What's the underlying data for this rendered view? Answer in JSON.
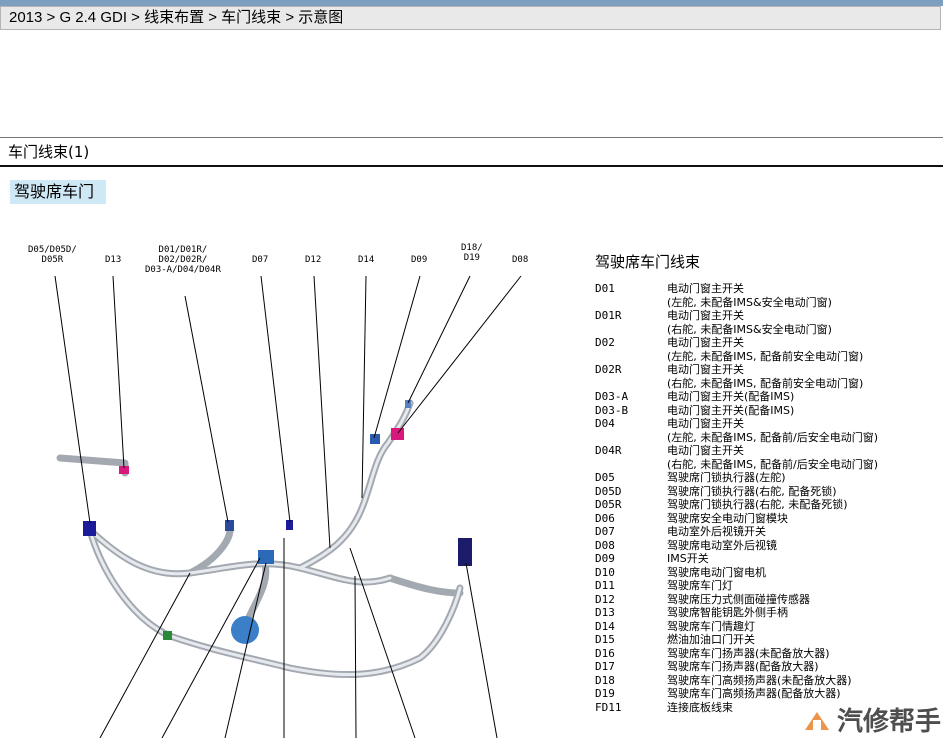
{
  "breadcrumb": "2013 > G 2.4 GDI > 线束布置 > 车门线束 > 示意图",
  "panel": {
    "title": "车门线束(1)",
    "section": "驾驶席车门"
  },
  "callouts": [
    {
      "id": "c1",
      "text": "D05/D05D/\nD05R"
    },
    {
      "id": "c2",
      "text": "D13"
    },
    {
      "id": "c3",
      "text": "D01/D01R/\nD02/D02R/\nD03-A/D04/D04R"
    },
    {
      "id": "c4",
      "text": "D07"
    },
    {
      "id": "c5",
      "text": "D12"
    },
    {
      "id": "c6",
      "text": "D14"
    },
    {
      "id": "c7",
      "text": "D09"
    },
    {
      "id": "c8",
      "text": "D18/\nD19"
    },
    {
      "id": "c9",
      "text": "D08"
    }
  ],
  "legend": {
    "title": "驾驶席车门线束",
    "items": [
      {
        "code": "D01",
        "desc": [
          "电动门窗主开关",
          "(左舵, 未配备IMS&安全电动门窗)"
        ]
      },
      {
        "code": "D01R",
        "desc": [
          "电动门窗主开关",
          "(右舵, 未配备IMS&安全电动门窗)"
        ]
      },
      {
        "code": "D02",
        "desc": [
          "电动门窗主开关",
          "(左舵, 未配备IMS, 配备前安全电动门窗)"
        ]
      },
      {
        "code": "D02R",
        "desc": [
          "电动门窗主开关",
          "(右舵, 未配备IMS, 配备前安全电动门窗)"
        ]
      },
      {
        "code": "D03-A",
        "desc": [
          "电动门窗主开关(配备IMS)"
        ]
      },
      {
        "code": "D03-B",
        "desc": [
          "电动门窗主开关(配备IMS)"
        ]
      },
      {
        "code": "D04",
        "desc": [
          "电动门窗主开关",
          "(左舵, 未配备IMS, 配备前/后安全电动门窗)"
        ]
      },
      {
        "code": "D04R",
        "desc": [
          "电动门窗主开关",
          "(右舵, 未配备IMS, 配备前/后安全电动门窗)"
        ]
      },
      {
        "code": "D05",
        "desc": [
          "驾驶席门锁执行器(左舵)"
        ]
      },
      {
        "code": "D05D",
        "desc": [
          "驾驶席门锁执行器(右舵, 配备死锁)"
        ]
      },
      {
        "code": "D05R",
        "desc": [
          "驾驶席门锁执行器(右舵, 未配备死锁)"
        ]
      },
      {
        "code": "D06",
        "desc": [
          "驾驶席安全电动门窗模块"
        ]
      },
      {
        "code": "D07",
        "desc": [
          "电动室外后视镜开关"
        ]
      },
      {
        "code": "D08",
        "desc": [
          "驾驶席电动室外后视镜"
        ]
      },
      {
        "code": "D09",
        "desc": [
          "IMS开关"
        ]
      },
      {
        "code": "D10",
        "desc": [
          "驾驶席电动门窗电机"
        ]
      },
      {
        "code": "D11",
        "desc": [
          "驾驶席车门灯"
        ]
      },
      {
        "code": "D12",
        "desc": [
          "驾驶席压力式侧面碰撞传感器"
        ]
      },
      {
        "code": "D13",
        "desc": [
          "驾驶席智能钥匙外侧手柄"
        ]
      },
      {
        "code": "D14",
        "desc": [
          "驾驶席车门情趣灯"
        ]
      },
      {
        "code": "D15",
        "desc": [
          "燃油加油口门开关"
        ]
      },
      {
        "code": "D16",
        "desc": [
          "驾驶席车门扬声器(未配备放大器)"
        ]
      },
      {
        "code": "D17",
        "desc": [
          "驾驶席车门扬声器(配备放大器)"
        ]
      },
      {
        "code": "D18",
        "desc": [
          "驾驶席车门高频扬声器(未配备放大器)"
        ]
      },
      {
        "code": "D19",
        "desc": [
          "驾驶席车门高频扬声器(配备放大器)"
        ]
      },
      {
        "code": "FD11",
        "desc": [
          "连接底板线束"
        ]
      }
    ]
  },
  "watermark": "汽修帮手",
  "colors": {
    "connector_blue": "#1c1c9a",
    "connector_magenta": "#d8187c",
    "harness_gray": "#c8cbd0",
    "connector_green": "#2a8a3a"
  }
}
